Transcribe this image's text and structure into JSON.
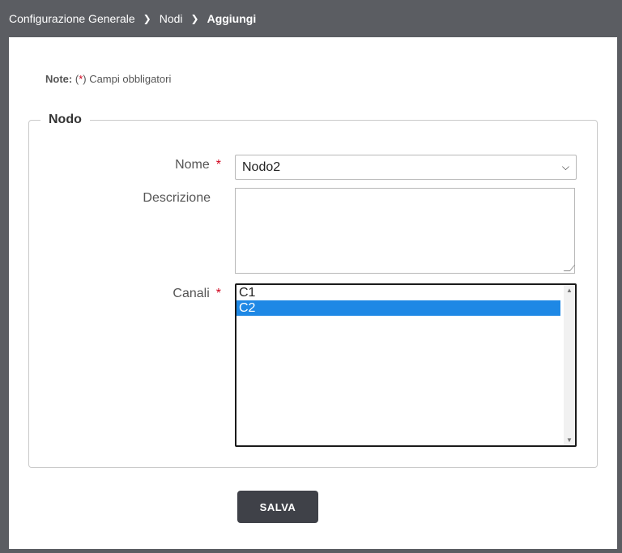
{
  "breadcrumb": {
    "items": [
      "Configurazione Generale",
      "Nodi",
      "Aggiungi"
    ]
  },
  "note": {
    "label": "Note:",
    "open_paren": "(",
    "star": "*",
    "text": ") Campi obbligatori"
  },
  "form": {
    "legend": "Nodo",
    "nome": {
      "label": "Nome",
      "required_mark": "*",
      "value": "Nodo2"
    },
    "descrizione": {
      "label": "Descrizione",
      "value": ""
    },
    "canali": {
      "label": "Canali",
      "required_mark": "*",
      "options": [
        {
          "label": "C1",
          "selected": false
        },
        {
          "label": "C2",
          "selected": true
        }
      ]
    }
  },
  "actions": {
    "save_label": "SALVA"
  },
  "colors": {
    "topbar": "#5b5d62",
    "required": "#d0021b",
    "selected_option": "#1e88e5",
    "button": "#3f4148"
  }
}
